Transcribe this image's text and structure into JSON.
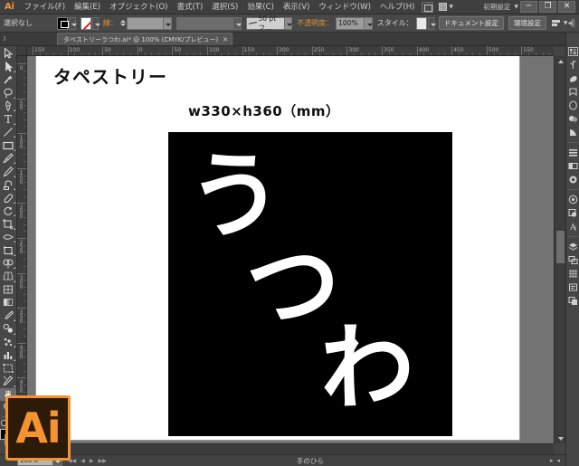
{
  "app": {
    "name": "Ai",
    "badge_label": "Ai"
  },
  "menubar": {
    "items": [
      {
        "label": "ファイル(F)",
        "name": "menu-file"
      },
      {
        "label": "編集(E)",
        "name": "menu-edit"
      },
      {
        "label": "オブジェクト(O)",
        "name": "menu-object"
      },
      {
        "label": "書式(T)",
        "name": "menu-type"
      },
      {
        "label": "選択(S)",
        "name": "menu-select"
      },
      {
        "label": "効果(C)",
        "name": "menu-effect"
      },
      {
        "label": "表示(V)",
        "name": "menu-view"
      },
      {
        "label": "ウィンドウ(W)",
        "name": "menu-window"
      },
      {
        "label": "ヘルプ(H)",
        "name": "menu-help"
      }
    ],
    "workspace": "初期設定",
    "window_controls": {
      "minimize": "─",
      "maximize": "❐",
      "close": "✕"
    }
  },
  "controlbar": {
    "selection_status": "選択なし",
    "fill_label": "塗り",
    "stroke_label": "線：",
    "stroke_weight": "",
    "stroke_profile": "",
    "brush_definition": "50 pt フ...",
    "opacity_label": "不透明度：",
    "opacity_value": "100%",
    "style_label": "スタイル：",
    "document_setup": "ドキュメント設定",
    "preferences": "環境設定"
  },
  "tabbar": {
    "document_title": "タペストリーうつわ.ai* @ 100% (CMYK/プレビュー)",
    "close_glyph": "✕"
  },
  "rulers": {
    "horizontal_labels": [
      "150",
      "100",
      "50",
      "0",
      "50",
      "100",
      "150",
      "200",
      "250",
      "300",
      "350",
      "400",
      "450",
      "500",
      "550"
    ],
    "vertical_labels": [
      "0",
      "50",
      "100",
      "150",
      "200",
      "250",
      "300",
      "350",
      "400",
      "450"
    ],
    "unit": "mm"
  },
  "toolbar": {
    "tools": [
      {
        "name": "selection-tool",
        "glyph": "selection"
      },
      {
        "name": "direct-selection-tool",
        "glyph": "direct-selection"
      },
      {
        "name": "magic-wand-tool",
        "glyph": "magic-wand"
      },
      {
        "name": "lasso-tool",
        "glyph": "lasso"
      },
      {
        "name": "pen-tool",
        "glyph": "pen"
      },
      {
        "name": "type-tool",
        "glyph": "type"
      },
      {
        "name": "line-segment-tool",
        "glyph": "line"
      },
      {
        "name": "rectangle-tool",
        "glyph": "rectangle"
      },
      {
        "name": "paintbrush-tool",
        "glyph": "paintbrush"
      },
      {
        "name": "pencil-tool",
        "glyph": "pencil"
      },
      {
        "name": "blob-brush-tool",
        "glyph": "blob-brush"
      },
      {
        "name": "eraser-tool",
        "glyph": "eraser"
      },
      {
        "name": "rotate-tool",
        "glyph": "rotate"
      },
      {
        "name": "scale-tool",
        "glyph": "scale"
      },
      {
        "name": "width-tool",
        "glyph": "width"
      },
      {
        "name": "free-transform-tool",
        "glyph": "free-transform"
      },
      {
        "name": "shape-builder-tool",
        "glyph": "shape-builder"
      },
      {
        "name": "perspective-grid-tool",
        "glyph": "perspective-grid"
      },
      {
        "name": "mesh-tool",
        "glyph": "mesh"
      },
      {
        "name": "gradient-tool",
        "glyph": "gradient"
      },
      {
        "name": "eyedropper-tool",
        "glyph": "eyedropper"
      },
      {
        "name": "blend-tool",
        "glyph": "blend"
      },
      {
        "name": "symbol-sprayer-tool",
        "glyph": "symbol-sprayer"
      },
      {
        "name": "column-graph-tool",
        "glyph": "column-graph"
      },
      {
        "name": "artboard-tool",
        "glyph": "artboard"
      },
      {
        "name": "slice-tool",
        "glyph": "slice"
      },
      {
        "name": "hand-tool",
        "glyph": "hand",
        "active": true
      },
      {
        "name": "zoom-tool",
        "glyph": "zoom"
      }
    ],
    "fill_color": "#000000",
    "stroke_color": "none"
  },
  "canvas": {
    "artwork": {
      "title": "タペストリー",
      "dimensions": "w330×h360（mm）",
      "panel_background": "#000000",
      "characters": [
        {
          "char": "う",
          "name": "kanji-u"
        },
        {
          "char": "つ",
          "name": "kanji-tsu"
        },
        {
          "char": "わ",
          "name": "kanji-wa"
        }
      ],
      "character_color": "#ffffff"
    }
  },
  "statusbar": {
    "zoom_level": "100%",
    "current_tool": "手のひら"
  },
  "dock": {
    "panels": [
      {
        "name": "panel-color",
        "glyph": "color"
      },
      {
        "name": "panel-color-guide",
        "glyph": "color-guide"
      },
      {
        "name": "panel-brushes",
        "glyph": "brushes"
      },
      {
        "name": "panel-symbols",
        "glyph": "symbols"
      },
      {
        "name": "panel-stroke",
        "glyph": "stroke"
      },
      {
        "name": "panel-gradient",
        "glyph": "gradient"
      },
      {
        "name": "panel-transparency",
        "glyph": "transparency"
      },
      {
        "name": "panel-align",
        "glyph": "align"
      },
      {
        "name": "panel-pathfinder",
        "glyph": "pathfinder"
      },
      {
        "name": "panel-transform",
        "glyph": "transform"
      },
      {
        "name": "panel-appearance",
        "glyph": "appearance"
      },
      {
        "name": "panel-graphic-styles",
        "glyph": "graphic-styles"
      },
      {
        "name": "panel-character",
        "glyph": "character"
      },
      {
        "name": "panel-layers",
        "glyph": "layers"
      },
      {
        "name": "panel-artboards",
        "glyph": "artboards"
      },
      {
        "name": "panel-links",
        "glyph": "links"
      },
      {
        "name": "panel-document-info",
        "glyph": "document-info"
      },
      {
        "name": "panel-separations",
        "glyph": "separations"
      }
    ]
  },
  "colors": {
    "accent": "#f59331",
    "chrome": "#444444",
    "panel": "#484848",
    "canvas": "#737373",
    "artboard": "#ffffff",
    "artwork_black": "#000000"
  }
}
